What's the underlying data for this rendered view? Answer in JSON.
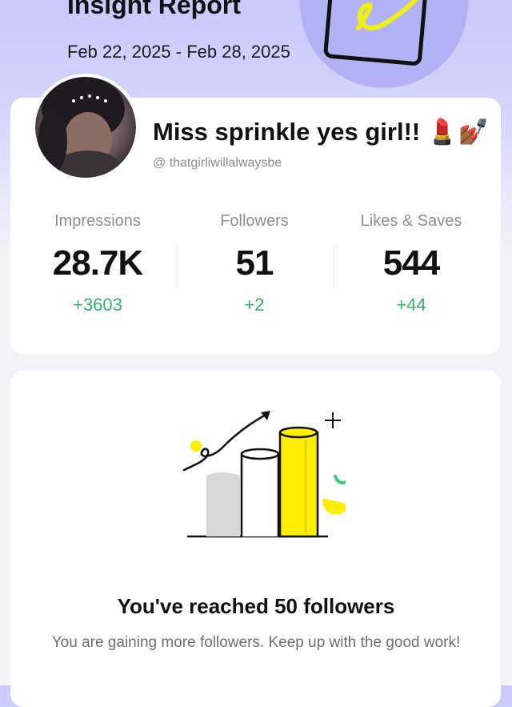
{
  "header": {
    "title": "Insight Report",
    "date_range": "Feb 22, 2025 - Feb 28, 2025"
  },
  "profile": {
    "name": "Miss sprinkle yes girl!! 💄💅🏾",
    "handle": "@ thatgirliwillalwaysbe"
  },
  "stats": [
    {
      "label": "Impressions",
      "value": "28.7K",
      "delta": "+3603"
    },
    {
      "label": "Followers",
      "value": "51",
      "delta": "+2"
    },
    {
      "label": "Likes & Saves",
      "value": "544",
      "delta": "+44"
    }
  ],
  "milestone": {
    "title": "You've reached 50 followers",
    "text": "You are gaining more followers. Keep up with the good work!"
  },
  "colors": {
    "accent_purple": "#c9c9fb",
    "positive_green": "#2fb36b",
    "chart_yellow": "#ffee00"
  }
}
